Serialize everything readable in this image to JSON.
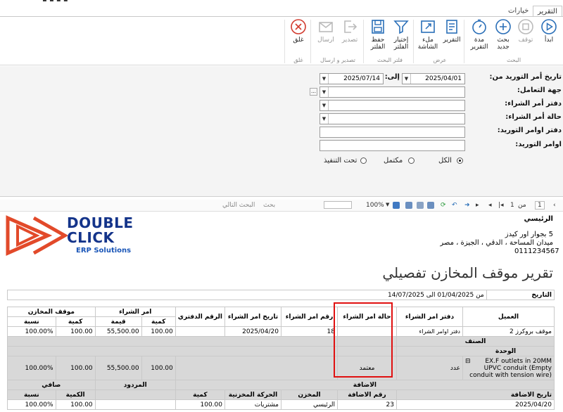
{
  "ribbon": {
    "tabs": [
      {
        "label": "التقرير",
        "active": true
      },
      {
        "label": "خيارات",
        "active": false
      }
    ],
    "buttons": [
      {
        "id": "start",
        "label": "ابدأ",
        "icon": "play-icon"
      },
      {
        "id": "stop",
        "label": "توقف",
        "icon": "stop-icon",
        "disabled": true
      },
      {
        "id": "new",
        "label": "بحث جديد",
        "icon": "plus-icon"
      },
      {
        "id": "duration",
        "label": "مدة التقرير",
        "icon": "timer-icon"
      },
      {
        "id": "report",
        "label": "التقرير",
        "icon": "report-icon"
      },
      {
        "id": "fullscreen",
        "label": "ملء الشاشة",
        "icon": "fullscreen-icon"
      },
      {
        "id": "choose_filter",
        "label": "إختيار الفلتر",
        "icon": "filter-icon"
      },
      {
        "id": "save_filter",
        "label": "حفظ الفلتر",
        "icon": "save-icon"
      },
      {
        "id": "export",
        "label": "تصدير",
        "icon": "export-icon",
        "disabled": true
      },
      {
        "id": "send",
        "label": "ارسال",
        "icon": "mail-icon",
        "disabled": true
      },
      {
        "id": "close",
        "label": "غلق",
        "icon": "close-icon"
      }
    ],
    "groups": {
      "search": "البحث",
      "view": "عرض",
      "search_filter": "فلتر البحث",
      "export_send": "تصدير و ارسال",
      "close": "غلق"
    }
  },
  "filters": {
    "date_label": "تاريخ أمر التوريد من:",
    "date_from": "2025/04/01",
    "to_label": "إلى:",
    "date_to": "2025/07/14",
    "party_label": "جهة التعامل:",
    "purchase_book_label": "دفتر أمر الشراء:",
    "purchase_status_label": "حالة أمر الشراء:",
    "supply_book_label": "دفتر اوامر التوريد:",
    "supply_orders_label": "اوامر التوريد:",
    "radios": [
      {
        "label": "الكل",
        "checked": true
      },
      {
        "label": "مكتمل",
        "checked": false
      },
      {
        "label": "تحت التنفيذ",
        "checked": false
      }
    ]
  },
  "toolbar": {
    "page_current": "1",
    "page_of": "من",
    "page_total": "1",
    "zoom": "100%",
    "find": "بحث",
    "find_next": "البحث التالي"
  },
  "report": {
    "logo_line1": "DOUBLE",
    "logo_line2": "CLICK",
    "logo_tag": "ERP Solutions",
    "company_name": "الرئيسي",
    "address_line1": "5 بجوار اور كيدز",
    "address_line2": "ميدان المساحة ، الدقي ، الجيزة ، مصر",
    "phone": "0111234567",
    "title": "تقرير موقف المخازن تفصيلي",
    "date_label": "التاريخ",
    "date_range": "من 01/04/2025 الى 14/07/2025",
    "headers": {
      "client": "العميل",
      "purchase_book": "دفتر امر الشراء",
      "purchase_status": "حالة امر الشراء",
      "purchase_no": "رقم امر الشراء",
      "purchase_date": "تاريخ امر الشراء",
      "book_no": "الرقم الدفتري",
      "purchase_order": "امر الشراء",
      "stock_status": "موقف المخازن",
      "qty": "كمية",
      "value": "قيمة",
      "ratio": "نسبة"
    },
    "row1": {
      "client": "موقف بروكرز 2",
      "purchase_book": "دفتر اوامر الشراء",
      "purchase_no": "18",
      "purchase_date": "2025/04/20",
      "qty": "100.00",
      "value": "55,500.00",
      "stock_qty": "100.00",
      "ratio": "100.00%"
    },
    "item_header": "الصنف",
    "unit_header": "الوحدة",
    "item": {
      "name": "EX.F outlets in 20MM UPVC conduit (Empty conduit with tension wire)",
      "unit": "عدد",
      "status": "معتمد",
      "qty": "100.00",
      "value": "55,500.00",
      "stock_qty": "100.00",
      "ratio": "100.00%"
    },
    "sub_headers": {
      "addition": "الاضافة",
      "returns": "المردود",
      "net": "صافي",
      "add_date": "تاريخ الاضافة",
      "add_no": "رقم الاضافة",
      "store": "المخزن",
      "movement": "الحركة المخزنية",
      "qty": "كمية",
      "ret_qty": "الكمية",
      "ret_ratio": "نسبة"
    },
    "sub_row": {
      "add_date": "2025/04/20",
      "add_no": "23",
      "store": "الرئيسي",
      "movement": "مشتريات",
      "qty": "100.00",
      "net_qty": "100.00",
      "net_ratio": "100.00%"
    }
  }
}
